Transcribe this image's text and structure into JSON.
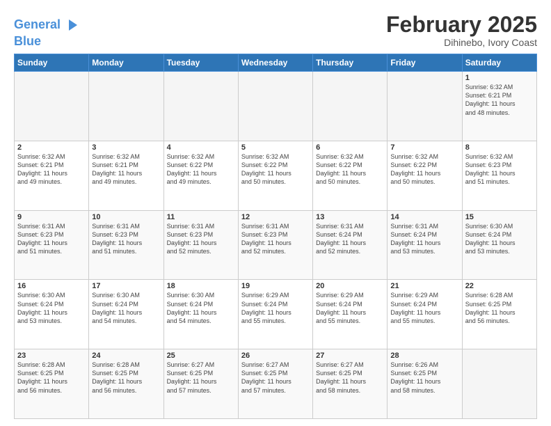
{
  "logo": {
    "line1": "General",
    "line2": "Blue"
  },
  "title": "February 2025",
  "subtitle": "Dihinebo, Ivory Coast",
  "days_header": [
    "Sunday",
    "Monday",
    "Tuesday",
    "Wednesday",
    "Thursday",
    "Friday",
    "Saturday"
  ],
  "weeks": [
    [
      {
        "num": "",
        "info": ""
      },
      {
        "num": "",
        "info": ""
      },
      {
        "num": "",
        "info": ""
      },
      {
        "num": "",
        "info": ""
      },
      {
        "num": "",
        "info": ""
      },
      {
        "num": "",
        "info": ""
      },
      {
        "num": "1",
        "info": "Sunrise: 6:32 AM\nSunset: 6:21 PM\nDaylight: 11 hours\nand 48 minutes."
      }
    ],
    [
      {
        "num": "2",
        "info": "Sunrise: 6:32 AM\nSunset: 6:21 PM\nDaylight: 11 hours\nand 49 minutes."
      },
      {
        "num": "3",
        "info": "Sunrise: 6:32 AM\nSunset: 6:21 PM\nDaylight: 11 hours\nand 49 minutes."
      },
      {
        "num": "4",
        "info": "Sunrise: 6:32 AM\nSunset: 6:22 PM\nDaylight: 11 hours\nand 49 minutes."
      },
      {
        "num": "5",
        "info": "Sunrise: 6:32 AM\nSunset: 6:22 PM\nDaylight: 11 hours\nand 50 minutes."
      },
      {
        "num": "6",
        "info": "Sunrise: 6:32 AM\nSunset: 6:22 PM\nDaylight: 11 hours\nand 50 minutes."
      },
      {
        "num": "7",
        "info": "Sunrise: 6:32 AM\nSunset: 6:22 PM\nDaylight: 11 hours\nand 50 minutes."
      },
      {
        "num": "8",
        "info": "Sunrise: 6:32 AM\nSunset: 6:23 PM\nDaylight: 11 hours\nand 51 minutes."
      }
    ],
    [
      {
        "num": "9",
        "info": "Sunrise: 6:31 AM\nSunset: 6:23 PM\nDaylight: 11 hours\nand 51 minutes."
      },
      {
        "num": "10",
        "info": "Sunrise: 6:31 AM\nSunset: 6:23 PM\nDaylight: 11 hours\nand 51 minutes."
      },
      {
        "num": "11",
        "info": "Sunrise: 6:31 AM\nSunset: 6:23 PM\nDaylight: 11 hours\nand 52 minutes."
      },
      {
        "num": "12",
        "info": "Sunrise: 6:31 AM\nSunset: 6:23 PM\nDaylight: 11 hours\nand 52 minutes."
      },
      {
        "num": "13",
        "info": "Sunrise: 6:31 AM\nSunset: 6:24 PM\nDaylight: 11 hours\nand 52 minutes."
      },
      {
        "num": "14",
        "info": "Sunrise: 6:31 AM\nSunset: 6:24 PM\nDaylight: 11 hours\nand 53 minutes."
      },
      {
        "num": "15",
        "info": "Sunrise: 6:30 AM\nSunset: 6:24 PM\nDaylight: 11 hours\nand 53 minutes."
      }
    ],
    [
      {
        "num": "16",
        "info": "Sunrise: 6:30 AM\nSunset: 6:24 PM\nDaylight: 11 hours\nand 53 minutes."
      },
      {
        "num": "17",
        "info": "Sunrise: 6:30 AM\nSunset: 6:24 PM\nDaylight: 11 hours\nand 54 minutes."
      },
      {
        "num": "18",
        "info": "Sunrise: 6:30 AM\nSunset: 6:24 PM\nDaylight: 11 hours\nand 54 minutes."
      },
      {
        "num": "19",
        "info": "Sunrise: 6:29 AM\nSunset: 6:24 PM\nDaylight: 11 hours\nand 55 minutes."
      },
      {
        "num": "20",
        "info": "Sunrise: 6:29 AM\nSunset: 6:24 PM\nDaylight: 11 hours\nand 55 minutes."
      },
      {
        "num": "21",
        "info": "Sunrise: 6:29 AM\nSunset: 6:24 PM\nDaylight: 11 hours\nand 55 minutes."
      },
      {
        "num": "22",
        "info": "Sunrise: 6:28 AM\nSunset: 6:25 PM\nDaylight: 11 hours\nand 56 minutes."
      }
    ],
    [
      {
        "num": "23",
        "info": "Sunrise: 6:28 AM\nSunset: 6:25 PM\nDaylight: 11 hours\nand 56 minutes."
      },
      {
        "num": "24",
        "info": "Sunrise: 6:28 AM\nSunset: 6:25 PM\nDaylight: 11 hours\nand 56 minutes."
      },
      {
        "num": "25",
        "info": "Sunrise: 6:27 AM\nSunset: 6:25 PM\nDaylight: 11 hours\nand 57 minutes."
      },
      {
        "num": "26",
        "info": "Sunrise: 6:27 AM\nSunset: 6:25 PM\nDaylight: 11 hours\nand 57 minutes."
      },
      {
        "num": "27",
        "info": "Sunrise: 6:27 AM\nSunset: 6:25 PM\nDaylight: 11 hours\nand 58 minutes."
      },
      {
        "num": "28",
        "info": "Sunrise: 6:26 AM\nSunset: 6:25 PM\nDaylight: 11 hours\nand 58 minutes."
      },
      {
        "num": "",
        "info": ""
      }
    ]
  ]
}
